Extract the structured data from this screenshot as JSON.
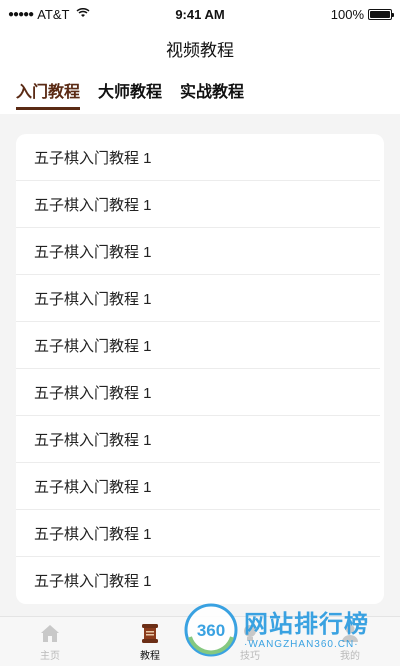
{
  "status_bar": {
    "carrier": "AT&T",
    "time": "9:41 AM",
    "battery": "100%",
    "battery_level": 1.0
  },
  "nav": {
    "title": "视频教程"
  },
  "tabs": [
    {
      "label": "入门教程",
      "active": true
    },
    {
      "label": "大师教程",
      "active": false
    },
    {
      "label": "实战教程",
      "active": false
    }
  ],
  "list": {
    "items": [
      "五子棋入门教程 1",
      "五子棋入门教程 1",
      "五子棋入门教程 1",
      "五子棋入门教程 1",
      "五子棋入门教程 1",
      "五子棋入门教程 1",
      "五子棋入门教程 1",
      "五子棋入门教程 1",
      "五子棋入门教程 1",
      "五子棋入门教程 1"
    ]
  },
  "tab_bar": {
    "items": [
      {
        "label": "主页",
        "icon": "home-icon",
        "active": false
      },
      {
        "label": "教程",
        "icon": "scroll-icon",
        "active": true
      },
      {
        "label": "技巧",
        "icon": "bulb-icon",
        "active": false
      },
      {
        "label": "我的",
        "icon": "user-icon",
        "active": false
      }
    ]
  },
  "watermark": {
    "logo_text": "360",
    "main_text": "网站排行榜",
    "sub_text": "·WANGZHAN360.CN·"
  },
  "colors": {
    "accent": "#5a2a14",
    "background": "#f4f4f4",
    "watermark": "#2a9be0"
  }
}
